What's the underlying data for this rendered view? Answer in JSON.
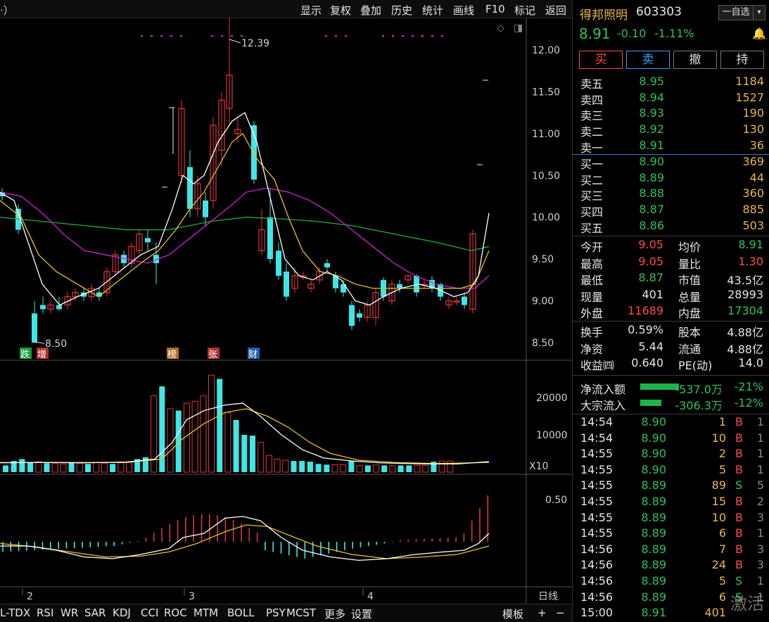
{
  "topbar": {
    "left_text": "·）",
    "menu": [
      "显示",
      "复权",
      "叠加",
      "历史",
      "统计",
      "画线",
      "F10",
      "标记",
      "返回"
    ]
  },
  "chart": {
    "price_axis": [
      "12.00",
      "11.50",
      "11.00",
      "10.50",
      "10.00",
      "9.50",
      "9.00",
      "8.50"
    ],
    "high_label": "12.39",
    "low_label": "8.50",
    "event_tags": [
      {
        "t": "跌",
        "c": "#1a9e3a"
      },
      {
        "t": "增",
        "c": "#b03030"
      },
      {
        "t": "榜",
        "c": "#b07020"
      },
      {
        "t": "张",
        "c": "#b03030"
      },
      {
        "t": "财",
        "c": "#2060b0"
      }
    ],
    "vol_axis": [
      "20000",
      "10000"
    ],
    "vol_unit": "X10",
    "macd_axis": [
      "0.50"
    ],
    "x_labels": [
      "2",
      "3",
      "4"
    ],
    "period": "日线",
    "colors": {
      "up": "#e0353d",
      "down": "#3fe6e6",
      "ma5": "#ffffff",
      "ma10": "#e8c020",
      "ma20": "#d020d0",
      "ma60": "#20b030"
    }
  },
  "bottom_tabs": [
    "L-TDX",
    "RSI",
    "WR",
    "SAR",
    "KDJ",
    "CCI",
    "ROC",
    "MTM",
    "BOLL",
    "PSY",
    "MCST",
    "更多",
    "设置"
  ],
  "bottom_right": [
    "模板",
    "+",
    "−"
  ],
  "stock": {
    "name": "得邦照明",
    "code": "603303",
    "price": "8.91",
    "change": "-0.10",
    "pct": "-1.11%",
    "watch_btn": "一自选",
    "drop": "▾"
  },
  "trade_btns": [
    {
      "t": "买",
      "fg": "#ff4a4a",
      "bd": "#ff4a4a"
    },
    {
      "t": "卖",
      "fg": "#3aa0ff",
      "bd": "#3aa0ff"
    },
    {
      "t": "撤",
      "fg": "#ddd",
      "bd": "#777"
    },
    {
      "t": "持",
      "fg": "#ddd",
      "bd": "#777"
    }
  ],
  "asks": [
    {
      "l": "卖五",
      "p": "8.95",
      "v": "1184"
    },
    {
      "l": "卖四",
      "p": "8.94",
      "v": "1527"
    },
    {
      "l": "卖三",
      "p": "8.93",
      "v": "190"
    },
    {
      "l": "卖二",
      "p": "8.92",
      "v": "130"
    },
    {
      "l": "卖一",
      "p": "8.91",
      "v": "36"
    }
  ],
  "bids": [
    {
      "l": "买一",
      "p": "8.90",
      "v": "369"
    },
    {
      "l": "买二",
      "p": "8.89",
      "v": "44"
    },
    {
      "l": "买三",
      "p": "8.88",
      "v": "360"
    },
    {
      "l": "买四",
      "p": "8.87",
      "v": "885"
    },
    {
      "l": "买五",
      "p": "8.86",
      "v": "503"
    }
  ],
  "info": [
    [
      {
        "k": "今开",
        "v": "9.05",
        "c": "#ff4a4a"
      },
      {
        "k": "均价",
        "v": "8.91",
        "c": "#2ec15a"
      }
    ],
    [
      {
        "k": "最高",
        "v": "9.05",
        "c": "#ff4a4a"
      },
      {
        "k": "量比",
        "v": "1.30",
        "c": "#ff4a4a"
      }
    ],
    [
      {
        "k": "最低",
        "v": "8.87",
        "c": "#2ec15a"
      },
      {
        "k": "市值",
        "v": "43.5亿",
        "c": "#e6e6e6"
      }
    ],
    [
      {
        "k": "现量",
        "v": "401",
        "c": "#e6e6e6"
      },
      {
        "k": "总量",
        "v": "28993",
        "c": "#e6e6e6"
      }
    ],
    [
      {
        "k": "外盘",
        "v": "11689",
        "c": "#ff4a4a"
      },
      {
        "k": "内盘",
        "v": "17304",
        "c": "#2ec15a"
      }
    ]
  ],
  "info2": [
    [
      {
        "k": "换手",
        "v": "0.59%"
      },
      {
        "k": "股本",
        "v": "4.88亿"
      }
    ],
    [
      {
        "k": "净资",
        "v": "5.44"
      },
      {
        "k": "流通",
        "v": "4.88亿"
      }
    ],
    [
      {
        "k": "收益㈣",
        "v": "0.640"
      },
      {
        "k": "PE(动)",
        "v": "14.0"
      }
    ]
  ],
  "flow": [
    {
      "k": "净流入额",
      "v": "-537.0万",
      "p": "-21%"
    },
    {
      "k": "大宗流入",
      "v": "-306.3万",
      "p": "-12%"
    }
  ],
  "ticks": [
    {
      "t": "14:54",
      "p": "8.90",
      "v": "1",
      "f": "B",
      "n": "1"
    },
    {
      "t": "14:54",
      "p": "8.90",
      "v": "10",
      "f": "B",
      "n": "1"
    },
    {
      "t": "14:55",
      "p": "8.90",
      "v": "2",
      "f": "B",
      "n": "1"
    },
    {
      "t": "14:55",
      "p": "8.90",
      "v": "5",
      "f": "B",
      "n": "1"
    },
    {
      "t": "14:55",
      "p": "8.89",
      "v": "89",
      "f": "S",
      "n": "5"
    },
    {
      "t": "14:55",
      "p": "8.89",
      "v": "15",
      "f": "B",
      "n": "2"
    },
    {
      "t": "14:55",
      "p": "8.89",
      "v": "10",
      "f": "B",
      "n": "3"
    },
    {
      "t": "14:55",
      "p": "8.89",
      "v": "6",
      "f": "B",
      "n": "1"
    },
    {
      "t": "14:56",
      "p": "8.89",
      "v": "7",
      "f": "B",
      "n": "3"
    },
    {
      "t": "14:56",
      "p": "8.89",
      "v": "24",
      "f": "B",
      "n": "3"
    },
    {
      "t": "14:56",
      "p": "8.89",
      "v": "5",
      "f": "S",
      "n": "1"
    },
    {
      "t": "14:56",
      "p": "8.89",
      "v": "6",
      "f": "S",
      "n": "1"
    },
    {
      "t": "15:00",
      "p": "8.91",
      "v": "401",
      "f": "",
      "n": ""
    }
  ],
  "watermark": "激活"
}
